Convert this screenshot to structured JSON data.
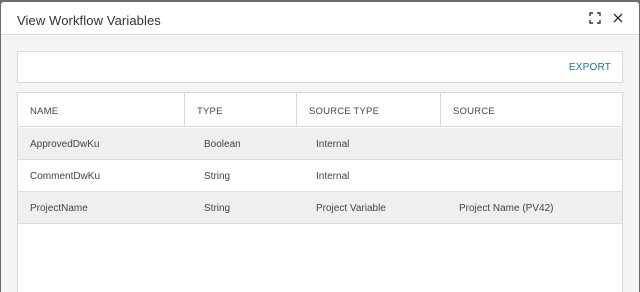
{
  "dialog": {
    "title": "View Workflow Variables"
  },
  "toolbar": {
    "export_label": "EXPORT"
  },
  "table": {
    "columns": [
      "NAME",
      "TYPE",
      "SOURCE TYPE",
      "SOURCE"
    ],
    "rows": [
      {
        "name": "ApprovedDwKu",
        "type": "Boolean",
        "source_type": "Internal",
        "source": ""
      },
      {
        "name": "CommentDwKu",
        "type": "String",
        "source_type": "Internal",
        "source": ""
      },
      {
        "name": "ProjectName",
        "type": "String",
        "source_type": "Project Variable",
        "source": "Project Name (PV42)"
      }
    ]
  },
  "icons": {
    "expand": "expand-icon",
    "close": "close-icon"
  },
  "colors": {
    "link": "#1e6fa8",
    "alt_row": "#efefef",
    "body_bg": "#f4f4f4"
  }
}
